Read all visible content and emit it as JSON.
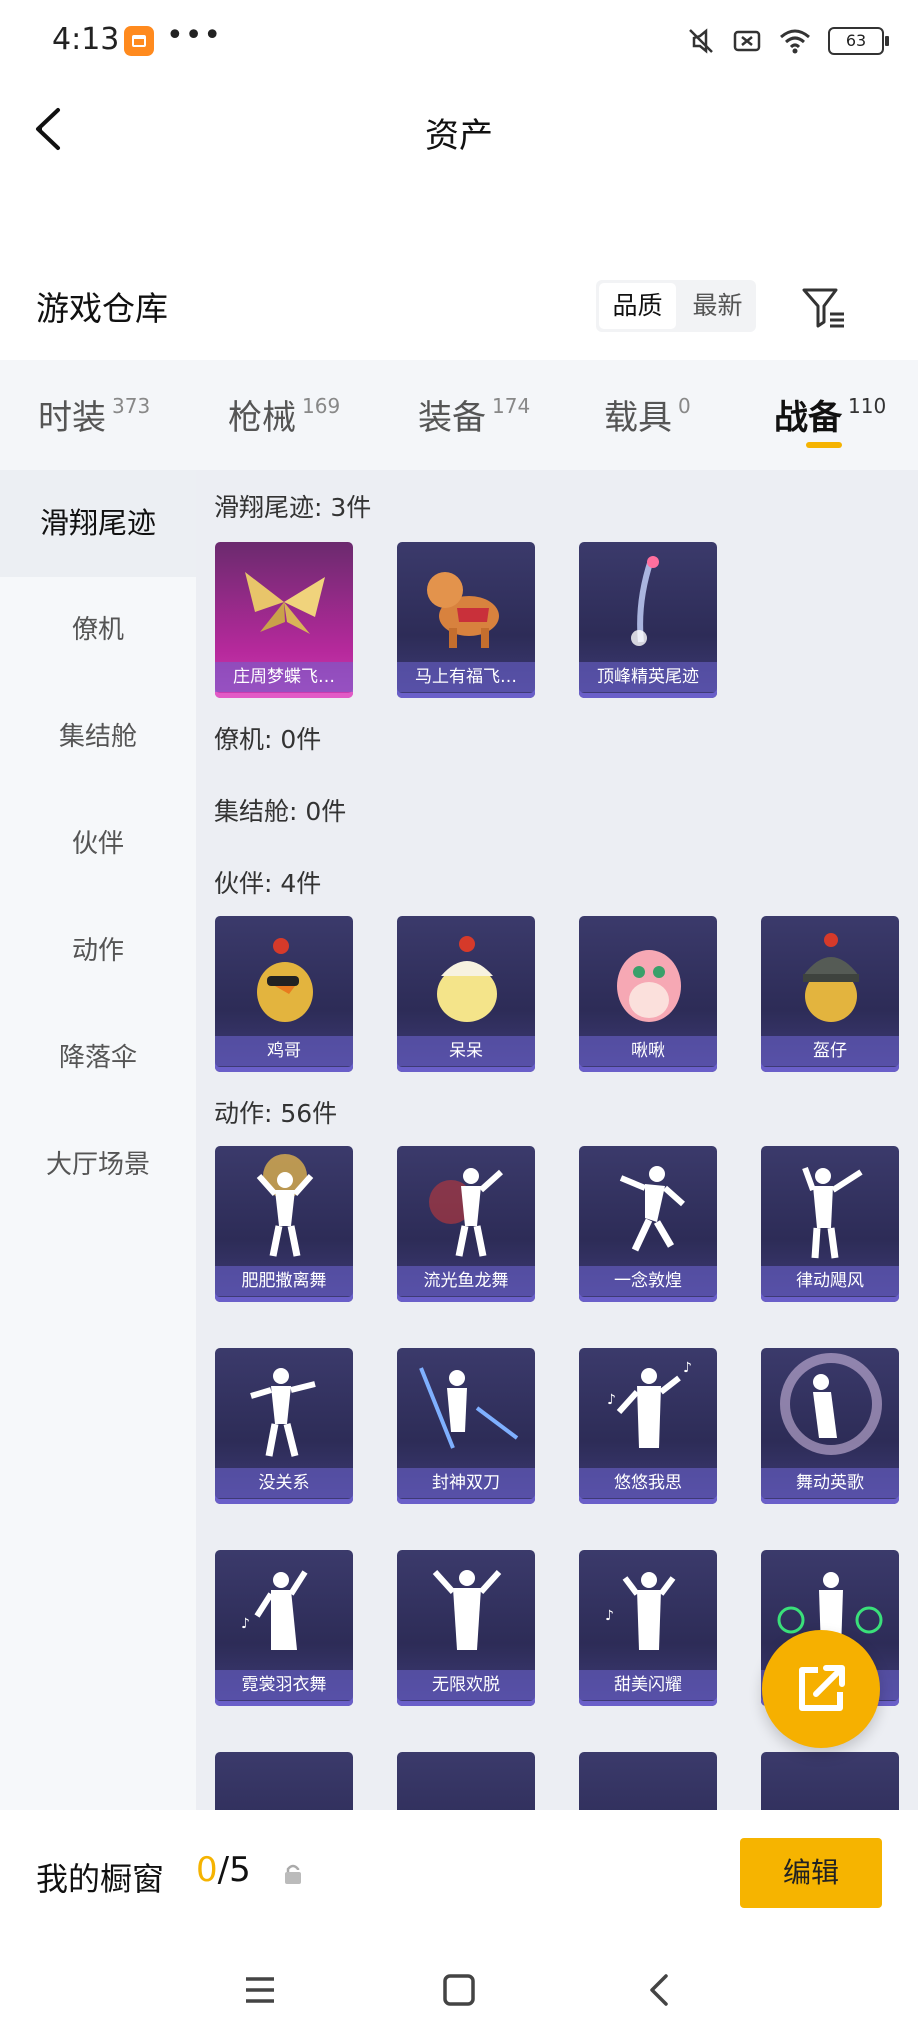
{
  "status_bar": {
    "time": "4:13",
    "more": "•••",
    "battery": "63"
  },
  "header": {
    "title": "资产"
  },
  "warehouse": {
    "title": "游戏仓库",
    "sort_options": [
      "品质",
      "最新"
    ],
    "sort_selected": "品质"
  },
  "tabs": [
    {
      "label": "时装",
      "count": "373"
    },
    {
      "label": "枪械",
      "count": "169"
    },
    {
      "label": "装备",
      "count": "174"
    },
    {
      "label": "载具",
      "count": "0"
    },
    {
      "label": "战备",
      "count": "110",
      "active": true
    }
  ],
  "sidebar": {
    "items": [
      "滑翔尾迹",
      "僚机",
      "集结舱",
      "伙伴",
      "动作",
      "降落伞",
      "大厅场景"
    ],
    "active": "滑翔尾迹"
  },
  "sections": {
    "glide": {
      "title": "滑翔尾迹: 3件",
      "items": [
        "庄周梦蝶飞…",
        "马上有福飞…",
        "顶峰精英尾迹"
      ]
    },
    "wingman": {
      "title": "僚机: 0件"
    },
    "pod": {
      "title": "集结舱: 0件"
    },
    "partner": {
      "title": "伙伴: 4件",
      "items": [
        "鸡哥",
        "呆呆",
        "啾啾",
        "盔仔"
      ]
    },
    "emote": {
      "title": "动作: 56件",
      "items": [
        "肥肥撒离舞",
        "流光鱼龙舞",
        "一念敦煌",
        "律动飓风",
        "没关系",
        "封神双刀",
        "悠悠我思",
        "舞动英歌",
        "霓裳羽衣舞",
        "无限欢脱",
        "甜美闪耀",
        ""
      ]
    }
  },
  "showcase": {
    "label": "我的橱窗",
    "current": "0",
    "total": "/5",
    "edit_label": "编辑"
  },
  "colors": {
    "accent": "#f5b301",
    "card_bg": "#2d2c57",
    "gold_card": "#b6299c"
  },
  "icons": [
    "back-arrow-icon",
    "filter-icon",
    "share-icon",
    "lock-icon",
    "menu-icon",
    "home-icon",
    "back-icon"
  ]
}
